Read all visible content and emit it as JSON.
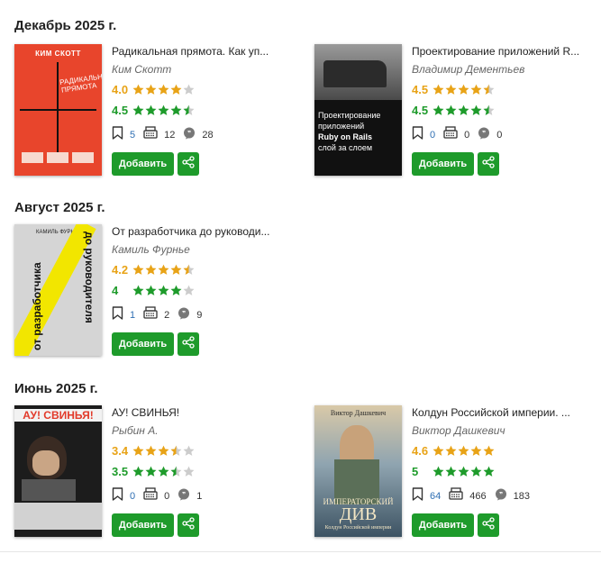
{
  "sections": [
    {
      "title": "Декабрь 2025 г.",
      "books": [
        {
          "title": "Радикальная прямота. Как уп...",
          "author": "Ким Скотт",
          "user_rating": "4.0",
          "user_stars": 4,
          "expert_rating": "4.5",
          "expert_stars": 4.5,
          "bookmarks": "5",
          "reviews": "12",
          "quotes": "28",
          "cover": {
            "bg": "#e8452c",
            "line1": "КИМ СКОТТ",
            "line2": "РАДИКАЛЬНАЯ",
            "line3": "ПРЯМОТА"
          }
        },
        {
          "title": "Проектирование приложений R...",
          "author": "Владимир Дементьев",
          "user_rating": "4.5",
          "user_stars": 4.5,
          "expert_rating": "4.5",
          "expert_stars": 4.5,
          "bookmarks": "0",
          "reviews": "0",
          "quotes": "0",
          "cover": {
            "bg": "#111111",
            "line1": "Проектирование",
            "line2": "приложений",
            "line3": "Ruby on Rails",
            "line4": "слой за слоем"
          }
        }
      ]
    },
    {
      "title": "Август 2025 г.",
      "books": [
        {
          "title": "От разработчика до руководи...",
          "author": "Камиль Фурнье",
          "user_rating": "4.2",
          "user_stars": 4.5,
          "expert_rating": "4",
          "expert_stars": 4,
          "bookmarks": "1",
          "reviews": "2",
          "quotes": "9",
          "cover": {
            "bg": "#d5d5d5",
            "line1": "КАМИЛЬ ФУРНЬЕ",
            "line2": "от разработчика",
            "line3": "до руководителя"
          }
        }
      ]
    },
    {
      "title": "Июнь 2025 г.",
      "books": [
        {
          "title": "АУ! СВИНЬЯ!",
          "author": "Рыбин А.",
          "user_rating": "3.4",
          "user_stars": 3.5,
          "expert_rating": "3.5",
          "expert_stars": 3.5,
          "bookmarks": "0",
          "reviews": "0",
          "quotes": "1",
          "cover": {
            "bg": "#1c1c1c",
            "line1": "АУ! СВИНЬЯ!"
          }
        },
        {
          "title": "Колдун Российской империи. ...",
          "author": "Виктор Дашкевич",
          "user_rating": "4.6",
          "user_stars": 5,
          "expert_rating": "5",
          "expert_stars": 5,
          "bookmarks": "64",
          "reviews": "466",
          "quotes": "183",
          "cover": {
            "bg": "#6f8a9e",
            "line1": "Виктор Дашкевич",
            "line2": "ИМПЕРАТОРСКИЙ",
            "line3": "ДИВ",
            "line4": "Колдун Российской империи"
          }
        }
      ]
    }
  ],
  "labels": {
    "add_button": "Добавить"
  },
  "colors": {
    "green": "#1e9b2b",
    "gold": "#e8a317",
    "star_empty": "#cccccc"
  }
}
